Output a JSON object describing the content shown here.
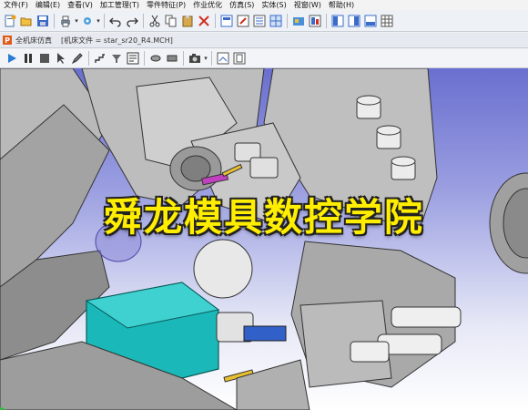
{
  "menu": {
    "items": [
      {
        "label": "文件(F)"
      },
      {
        "label": "编辑(E)"
      },
      {
        "label": "查看(V)"
      },
      {
        "label": "加工管理(T)"
      },
      {
        "label": "零件特征(P)"
      },
      {
        "label": "作业优化"
      },
      {
        "label": "仿真(S)"
      },
      {
        "label": "实体(S)"
      },
      {
        "label": "视窗(W)"
      },
      {
        "label": "帮助(H)"
      }
    ]
  },
  "toolbar": {
    "icons": [
      "new-icon",
      "open-icon",
      "save-icon",
      "print-icon",
      "settings-icon",
      "undo-icon",
      "redo-icon",
      "cut-icon",
      "copy-icon",
      "paste-icon",
      "delete-icon",
      "view-top-icon",
      "edit-icon",
      "list-icon",
      "grid-icon",
      "machine-icon",
      "tool-icon",
      "layout-icon",
      "panel-icon",
      "window-icon",
      "table-icon"
    ]
  },
  "tab": {
    "logo": "P",
    "title": "全机床仿真",
    "file_label": "[机床文件 = star_sr20_R4.MCH]"
  },
  "sim_controls": {
    "icons": [
      "play-icon",
      "pause-icon",
      "stop-icon",
      "cursor-icon",
      "pencil-icon",
      "step-icon",
      "tool-path-icon",
      "report-icon",
      "rotate-icon",
      "pan-icon",
      "camera-icon",
      "copy-view-icon",
      "image-icon"
    ]
  },
  "watermark": "舜龙模具数控学院",
  "colors": {
    "accent": "#e05a1a",
    "watermark": "#ffee00",
    "tool_teal": "#1ab8b8",
    "machine_gray": "#a8a8a8"
  }
}
